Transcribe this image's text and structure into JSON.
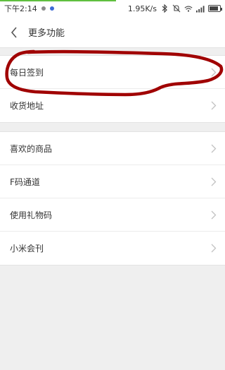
{
  "status_bar": {
    "time": "下午2:14",
    "network_speed": "1.95K/s",
    "battery_level": 0.85
  },
  "header": {
    "title": "更多功能"
  },
  "groups": [
    {
      "items": [
        {
          "label": "每日签到"
        },
        {
          "label": "收货地址"
        }
      ]
    },
    {
      "items": [
        {
          "label": "喜欢的商品"
        },
        {
          "label": "F码通道"
        },
        {
          "label": "使用礼物码"
        },
        {
          "label": "小米会刊"
        }
      ]
    }
  ],
  "colors": {
    "annotation": "#a00000",
    "progress": "#5fbf3f"
  }
}
